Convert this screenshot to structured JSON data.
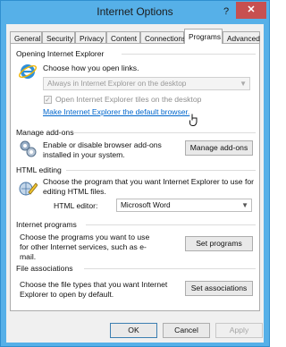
{
  "window": {
    "title": "Internet Options",
    "help_label": "?",
    "close_label": "✕"
  },
  "tabs": [
    "General",
    "Security",
    "Privacy",
    "Content",
    "Connections",
    "Programs",
    "Advanced"
  ],
  "active_tab": "Programs",
  "opening": {
    "group_label": "Opening Internet Explorer",
    "prompt": "Choose how you open links.",
    "select_value": "Always in Internet Explorer on the desktop",
    "checkbox_label": "Open Internet Explorer tiles on the desktop",
    "checkbox_checked": true,
    "default_link": "Make Internet Explorer the default browser."
  },
  "addons": {
    "group_label": "Manage add-ons",
    "description": "Enable or disable browser add-ons installed in your system.",
    "button": "Manage add-ons"
  },
  "html_editing": {
    "group_label": "HTML editing",
    "description": "Choose the program that you want Internet Explorer to use for editing HTML files.",
    "editor_label": "HTML editor:",
    "editor_value": "Microsoft Word"
  },
  "internet_programs": {
    "group_label": "Internet programs",
    "description": "Choose the programs you want to use for other Internet services, such as e-mail.",
    "button": "Set programs"
  },
  "file_assoc": {
    "group_label": "File associations",
    "description": "Choose the file types that you want Internet Explorer to open by default.",
    "button": "Set associations"
  },
  "footer": {
    "ok": "OK",
    "cancel": "Cancel",
    "apply": "Apply"
  }
}
